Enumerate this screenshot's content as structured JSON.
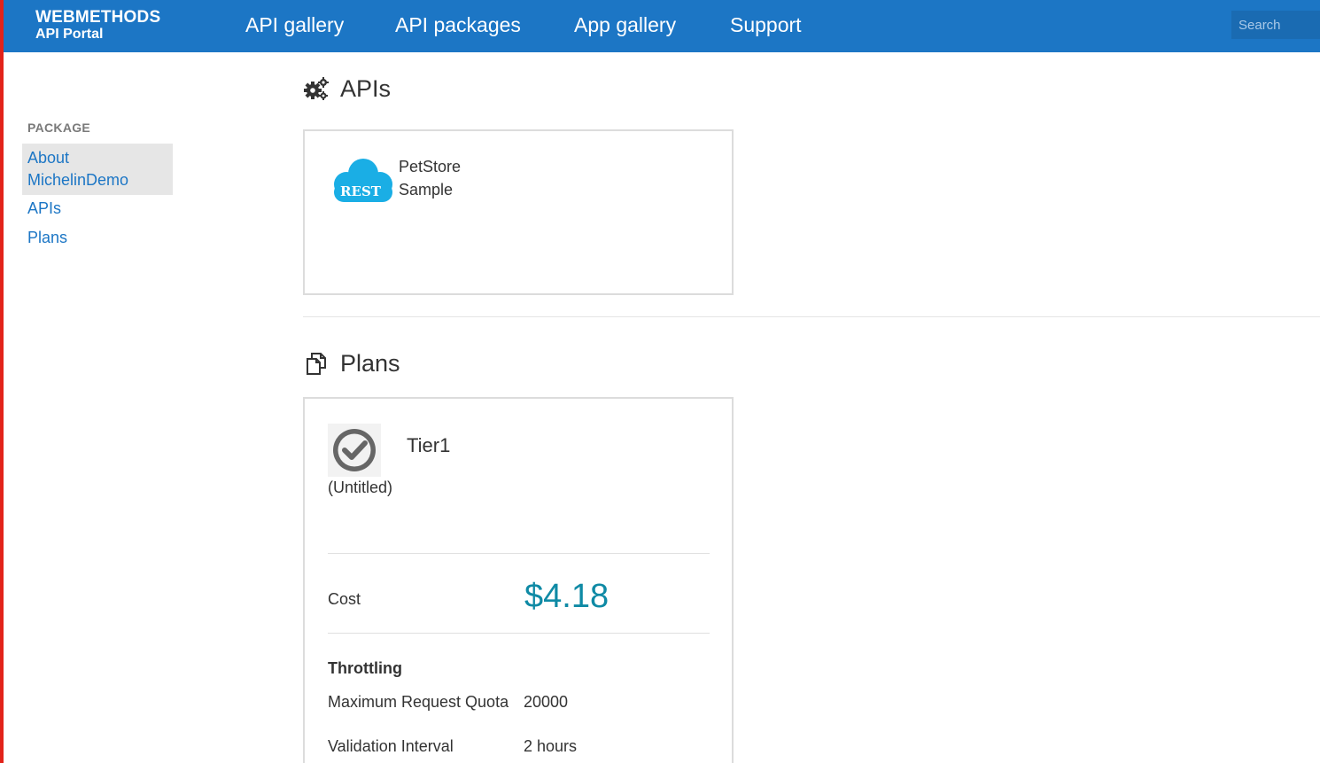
{
  "colors": {
    "header_bg": "#1c76c5",
    "link": "#1c76c5",
    "price": "#0f8aa5",
    "left_edge": "#e2231a",
    "rest_badge": "#1aaee5"
  },
  "header": {
    "brand_name": "WEBMETHODS",
    "brand_sub": "API Portal",
    "nav": [
      {
        "label": "API gallery"
      },
      {
        "label": "API packages"
      },
      {
        "label": "App gallery"
      },
      {
        "label": "Support"
      }
    ],
    "search": {
      "placeholder": "Search",
      "value": ""
    }
  },
  "sidebar": {
    "heading": "PACKAGE",
    "items": [
      {
        "label_line1": "About",
        "label_line2": "MichelinDemo",
        "active": true
      },
      {
        "label": "APIs"
      },
      {
        "label": "Plans"
      }
    ]
  },
  "apis_section": {
    "title": "APIs",
    "icon": "gears-icon",
    "cards": [
      {
        "badge": "REST",
        "icon": "rest-cloud-icon",
        "name_line1": "PetStore",
        "name_line2": "Sample"
      }
    ]
  },
  "plans_section": {
    "title": "Plans",
    "icon": "copy-icon",
    "plan": {
      "icon": "check-circle-icon",
      "caption": "(Untitled)",
      "name": "Tier1",
      "cost_label": "Cost",
      "cost_value": "$4.18",
      "throttling_heading": "Throttling",
      "rows": [
        {
          "label": "Maximum Request Quota",
          "value": "20000"
        },
        {
          "label": "Validation Interval",
          "value": "2 hours"
        }
      ]
    }
  }
}
